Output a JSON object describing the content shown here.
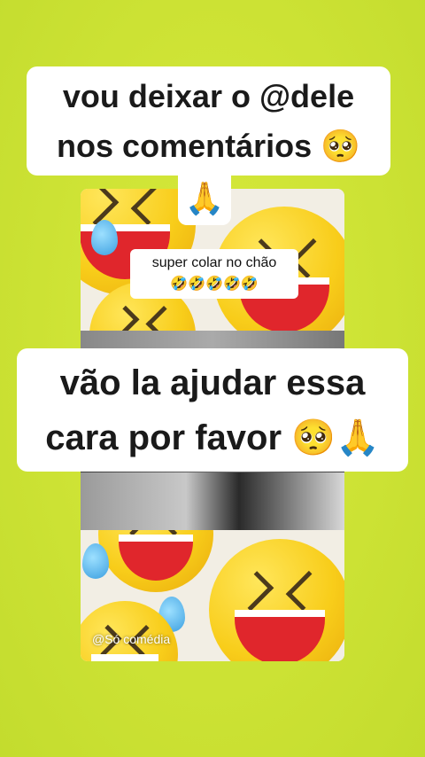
{
  "overlay_top": {
    "line1": "vou deixar o @dele",
    "line2": "nos comentários 🥺",
    "line3": "🙏"
  },
  "caption_small": {
    "line1": "super colar no chão",
    "line2": "🤣🤣🤣🤣🤣"
  },
  "overlay_middle": {
    "line1": "vão la ajudar essa",
    "line2": "cara por favor 🥺🙏"
  },
  "watermark": "@Só comédia",
  "colors": {
    "background": "#cfe436",
    "bubble": "#ffffff",
    "text": "#1a1a1a"
  }
}
